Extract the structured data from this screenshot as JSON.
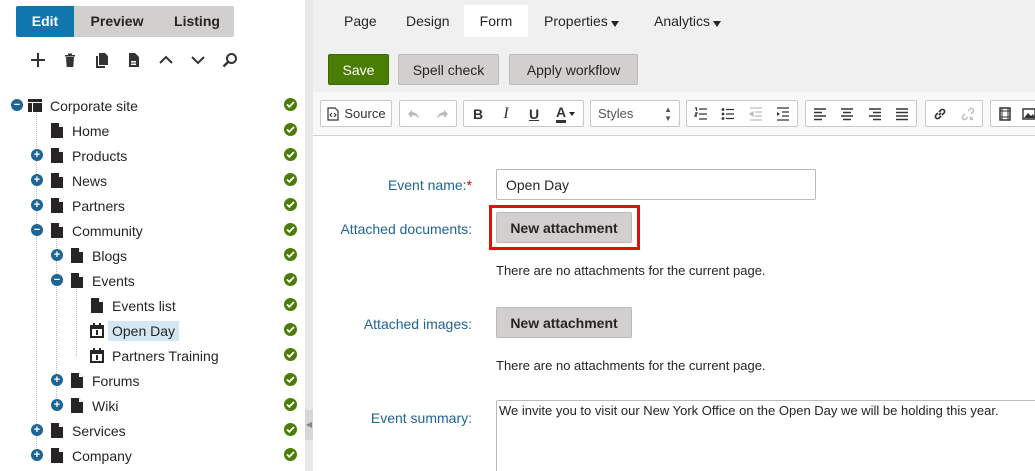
{
  "mode_tabs": [
    "Edit",
    "Preview",
    "Listing"
  ],
  "tree": [
    {
      "label": "Corporate site",
      "icon": "site-icon",
      "toggle": "-"
    },
    {
      "label": "Home",
      "icon": "page-icon",
      "toggle": ""
    },
    {
      "label": "Products",
      "icon": "page-icon",
      "toggle": "+"
    },
    {
      "label": "News",
      "icon": "page-icon",
      "toggle": "+"
    },
    {
      "label": "Partners",
      "icon": "page-icon",
      "toggle": "+"
    },
    {
      "label": "Community",
      "icon": "page-icon",
      "toggle": "-"
    },
    {
      "label": "Blogs",
      "icon": "page-icon",
      "toggle": "+"
    },
    {
      "label": "Events",
      "icon": "page-icon",
      "toggle": "-"
    },
    {
      "label": "Events list",
      "icon": "page-icon",
      "toggle": ""
    },
    {
      "label": "Open Day",
      "icon": "calendar-icon",
      "toggle": "",
      "selected": true
    },
    {
      "label": "Partners Training",
      "icon": "calendar-icon",
      "toggle": ""
    },
    {
      "label": "Forums",
      "icon": "page-icon",
      "toggle": "+"
    },
    {
      "label": "Wiki",
      "icon": "page-icon",
      "toggle": "+"
    },
    {
      "label": "Services",
      "icon": "page-icon",
      "toggle": "+"
    },
    {
      "label": "Company",
      "icon": "page-icon",
      "toggle": "+"
    }
  ],
  "view_tabs": [
    "Page",
    "Design",
    "Form",
    "Properties",
    "Analytics"
  ],
  "actions": {
    "save": "Save",
    "spell_check": "Spell check",
    "apply_workflow": "Apply workflow"
  },
  "editor_toolbar": {
    "source": "Source",
    "styles": "Styles"
  },
  "form": {
    "event_name_label": "Event name:",
    "required_mark": "*",
    "event_name_value": "Open Day",
    "attached_documents_label": "Attached documents:",
    "attached_images_label": "Attached images:",
    "new_attachment": "New attachment",
    "no_attachments": "There are no attachments for the current page.",
    "event_summary_label": "Event summary:",
    "event_summary_value": "We invite you to visit our New York Office on the Open Day we will be holding this year."
  },
  "colors": {
    "accent": "#1175ae",
    "save": "#497d04",
    "highlight": "#e01010",
    "label": "#1e6495"
  }
}
